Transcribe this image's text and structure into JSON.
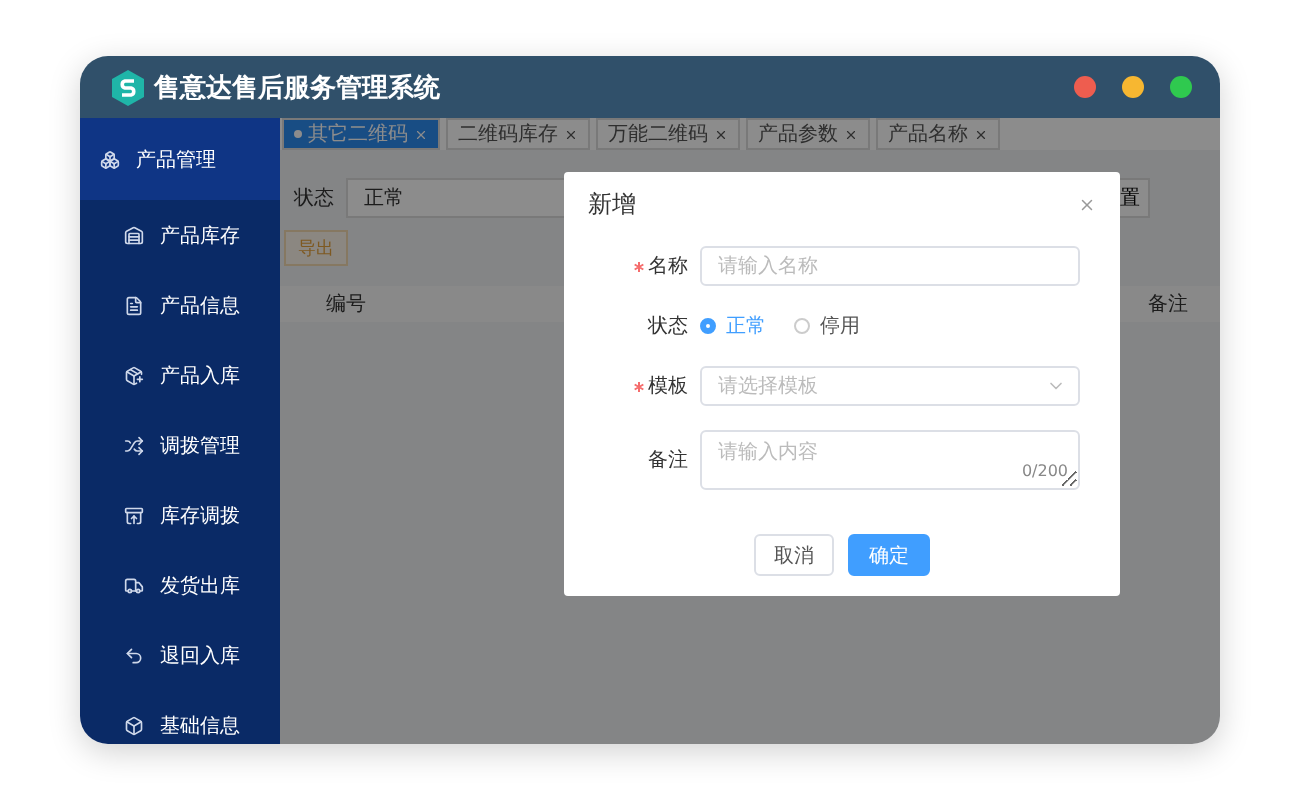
{
  "window": {
    "title": "售意达售后服务管理系统"
  },
  "sidebar": {
    "group": {
      "label": "产品管理",
      "selected": true
    },
    "items": [
      {
        "label": "产品库存",
        "selected": false
      },
      {
        "label": "产品信息",
        "selected": false
      },
      {
        "label": "产品入库",
        "selected": false
      },
      {
        "label": "调拨管理",
        "selected": false
      },
      {
        "label": "库存调拨",
        "selected": false
      },
      {
        "label": "发货出库",
        "selected": false
      },
      {
        "label": "退回入库",
        "selected": false
      },
      {
        "label": "基础信息",
        "selected": false
      }
    ]
  },
  "tabs": [
    {
      "label": "其它二维码",
      "selected": true
    },
    {
      "label": "二维码库存",
      "selected": false
    },
    {
      "label": "万能二维码",
      "selected": false
    },
    {
      "label": "产品参数",
      "selected": false
    },
    {
      "label": "产品名称",
      "selected": false
    }
  ],
  "filter": {
    "label": "状态",
    "value": "正常",
    "button": "置"
  },
  "export_button": "导出",
  "table": {
    "columns": [
      "编号",
      "备注"
    ]
  },
  "dialog": {
    "title": "新增",
    "fields": [
      {
        "kind": "input",
        "label": "名称",
        "required": true,
        "placeholder": "请输入名称"
      },
      {
        "kind": "radio",
        "label": "状态",
        "required": false,
        "options": [
          {
            "label": "正常",
            "selected": true
          },
          {
            "label": "停用",
            "selected": false
          }
        ]
      },
      {
        "kind": "select",
        "label": "模板",
        "required": true,
        "placeholder": "请选择模板"
      },
      {
        "kind": "textarea",
        "label": "备注",
        "required": false,
        "placeholder": "请输入内容",
        "counter": "0/200"
      }
    ],
    "buttons": [
      {
        "label": "取消",
        "kind": "default"
      },
      {
        "label": "确定",
        "kind": "primary"
      }
    ]
  }
}
